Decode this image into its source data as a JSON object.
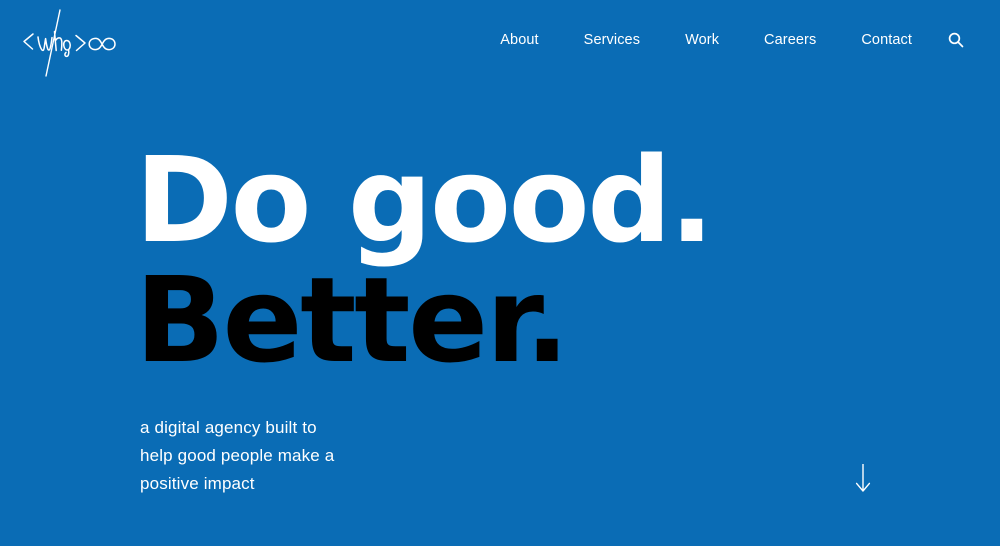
{
  "site": {
    "background_color": "#0a6cb5",
    "logo_alt": "who-infinity-logo"
  },
  "nav": {
    "items": [
      {
        "label": "About"
      },
      {
        "label": "Services"
      },
      {
        "label": "Work"
      },
      {
        "label": "Careers"
      },
      {
        "label": "Contact"
      }
    ],
    "search_label": "search-icon"
  },
  "hero": {
    "headline_line_1": "Do good.",
    "headline_line_2": "Better.",
    "headline_line_1_color": "#ffffff",
    "headline_line_2_color": "#000000",
    "subhead_line_1": "a digital agency built to",
    "subhead_line_2": "help good people make a",
    "subhead_line_3": "positive impact"
  },
  "scroll": {
    "indicator_label": "scroll-down-arrow"
  }
}
